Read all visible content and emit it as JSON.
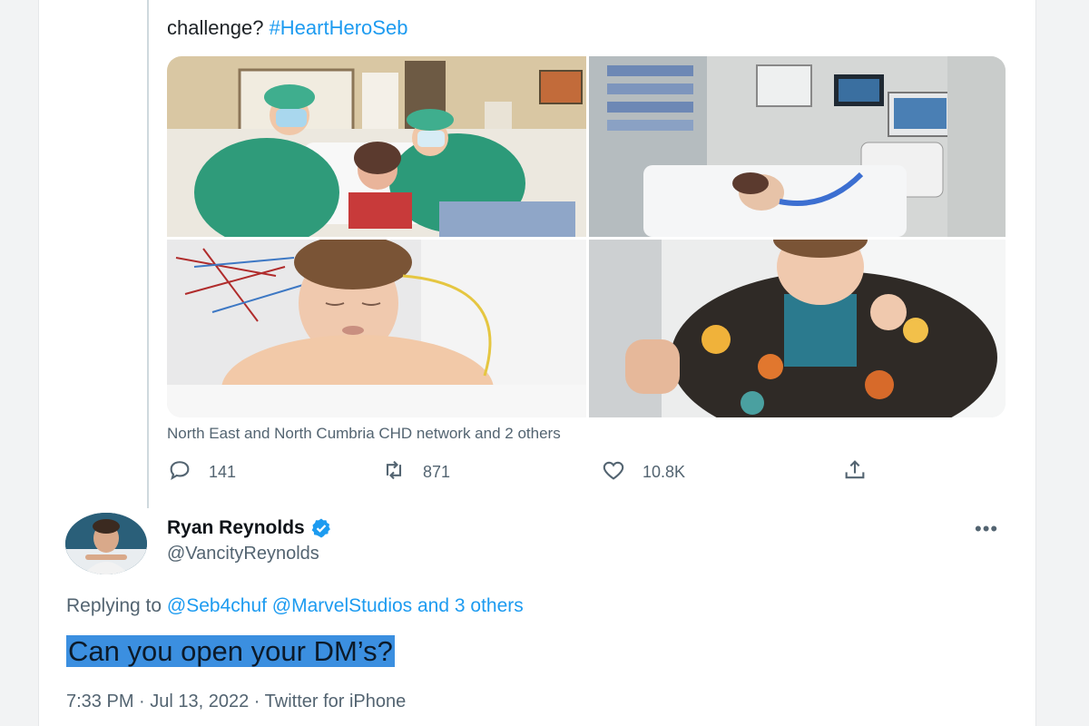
{
  "tweet_context": {
    "challenge_text": "challenge?",
    "hashtag": "#HeartHeroSeb",
    "media_tags": "North East and North Cumbria CHD network and 2 others",
    "actions": {
      "reply_count": "141",
      "retweet_count": "871",
      "like_count": "10.8K"
    },
    "icons": [
      "reply-icon",
      "retweet-icon",
      "like-icon",
      "share-icon"
    ]
  },
  "reply": {
    "author_name": "Ryan Reynolds",
    "handle": "@VancityReynolds",
    "verified": true,
    "replying_label": "Replying to",
    "mentions": "@Seb4chuf @MarvelStudios and 3 others",
    "text": "Can you open your DM’s?",
    "timestamp": "7:33 PM · Jul 13, 2022 · Twitter for iPhone",
    "more_label": "•••"
  },
  "colors": {
    "accent": "#1d9bf0",
    "secondary_text": "#536471",
    "highlight": "#3b8fe0"
  }
}
